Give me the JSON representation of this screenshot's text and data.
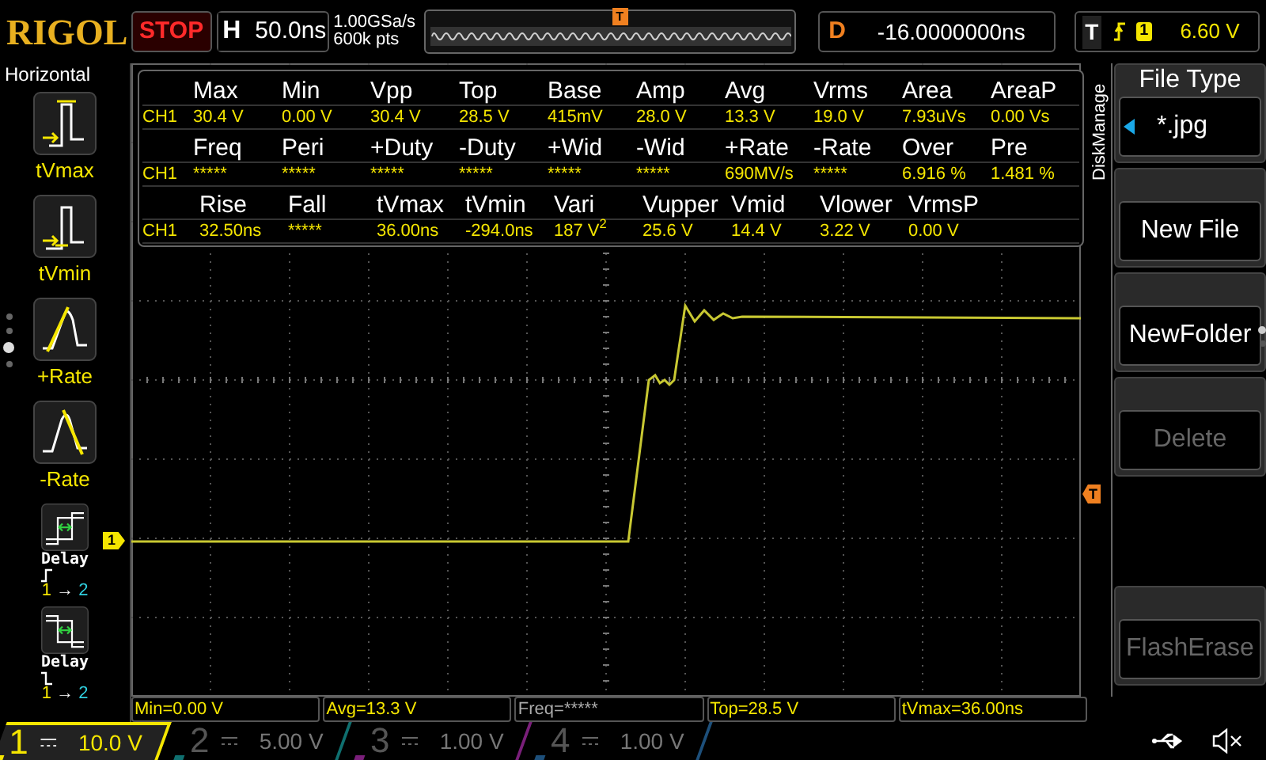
{
  "top_bar": {
    "logo": "RIGOL",
    "run_state": "STOP",
    "horizontal": {
      "label": "H",
      "timebase": "50.0ns"
    },
    "sample_rate": "1.00GSa/s",
    "memory_depth": "600k pts",
    "overview_trigger": "T",
    "delay": {
      "label": "D",
      "value": "-16.0000000ns"
    },
    "trigger": {
      "label": "T",
      "source": "1",
      "level": "6.60 V"
    }
  },
  "sidebar": {
    "title": "Horizontal",
    "items": [
      {
        "kind": "tvmax",
        "label": "tVmax"
      },
      {
        "kind": "tvmin",
        "label": "tVmin"
      },
      {
        "kind": "rise_rate",
        "label": "+Rate"
      },
      {
        "kind": "fall_rate",
        "label": "-Rate"
      },
      {
        "kind": "delay_rise",
        "label": "Delay",
        "source": "1",
        "arrow": "→",
        "target": "2"
      },
      {
        "kind": "delay_fall",
        "label": "Delay",
        "source": "1",
        "arrow": "→",
        "target": "2"
      }
    ],
    "page_dots": [
      {
        "selected": false
      },
      {
        "selected": false
      },
      {
        "selected": true
      },
      {
        "selected": false
      }
    ]
  },
  "screen": {
    "channel_marker": "1",
    "trigger_level_marker": "T"
  },
  "measurements": {
    "groups": [
      {
        "headers": [
          "Max",
          "Min",
          "Vpp",
          "Top",
          "Base",
          "Amp",
          "Avg",
          "Vrms",
          "Area",
          "AreaP"
        ],
        "channel": "CH1",
        "values": [
          "30.4 V",
          "0.00 V",
          "30.4 V",
          "28.5 V",
          "415mV",
          "28.0 V",
          "13.3 V",
          "19.0 V",
          "7.93uVs",
          "0.00 Vs"
        ]
      },
      {
        "headers": [
          "Freq",
          "Peri",
          "+Duty",
          "-Duty",
          "+Wid",
          "-Wid",
          "+Rate",
          "-Rate",
          "Over",
          "Pre"
        ],
        "channel": "CH1",
        "values": [
          "*****",
          "*****",
          "*****",
          "*****",
          "*****",
          "*****",
          "690MV/s",
          "*****",
          "6.916 %",
          "1.481 %"
        ]
      },
      {
        "headers": [
          "Rise",
          "Fall",
          "tVmax",
          "tVmin",
          "Vari",
          "Vupper",
          "Vmid",
          "Vlower",
          "VrmsP"
        ],
        "channel": "CH1",
        "values": [
          "32.50ns",
          "*****",
          "36.00ns",
          "-294.0ns",
          "187 V$^{2}$",
          "25.6 V",
          "14.4 V",
          "3.22 V",
          "0.00 V"
        ]
      }
    ]
  },
  "menu": {
    "title": "DiskManage",
    "items": [
      {
        "kind": "select",
        "label": "File Type",
        "value": "*.jpg"
      },
      {
        "kind": "button",
        "label": "New File",
        "disabled": false
      },
      {
        "kind": "button",
        "label": "NewFolder",
        "disabled": false
      },
      {
        "kind": "button",
        "label": "Delete",
        "disabled": true
      },
      {
        "kind": "spacer"
      },
      {
        "kind": "button",
        "label": "FlashErase",
        "disabled": true
      }
    ],
    "page_dots": [
      {
        "selected": true
      },
      {
        "selected": false
      }
    ]
  },
  "measure_bar": [
    "Min=0.00 V",
    "Avg=13.3 V",
    "Freq=*****",
    "Top=28.5 V",
    "tVmax=36.00ns"
  ],
  "channels": [
    {
      "number": "1",
      "scale": "10.0 V",
      "on": true,
      "color": "#f5e600"
    },
    {
      "number": "2",
      "scale": "5.00 V",
      "on": false,
      "color": "#0f6f6f"
    },
    {
      "number": "3",
      "scale": "1.00 V",
      "on": false,
      "color": "#7a1f7a"
    },
    {
      "number": "4",
      "scale": "1.00 V",
      "on": false,
      "color": "#1d4f7a"
    }
  ]
}
